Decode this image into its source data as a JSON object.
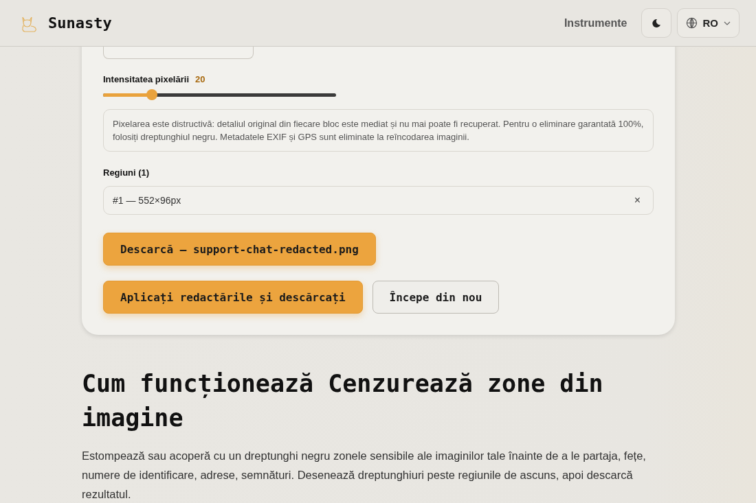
{
  "header": {
    "brand": "Sunasty",
    "nav_link": "Instrumente",
    "language": "RO"
  },
  "intensity": {
    "label": "Intensitatea pixelării",
    "reading": "20",
    "level": 0.21
  },
  "notice": "Pixelarea este distructivă: detaliul original din fiecare bloc este mediat și nu mai poate fi recuperat. Pentru o eliminare garantată 100%, folosiți dreptunghiul negru. Metadatele EXIF și GPS sunt eliminate la reîncodarea imaginii.",
  "regions": {
    "label": "Regiuni (1)",
    "items": [
      {
        "text": "#1 — 552×96px",
        "remove": "×"
      }
    ]
  },
  "download_button": "Descarcă — support-chat-redacted.png",
  "actions": [
    {
      "label": "Aplicați redactările și descărcați",
      "kind": "primary"
    },
    {
      "label": "Începe din nou",
      "kind": "secondary"
    }
  ],
  "article": {
    "heading": "Cum funcționează Cenzurează zone din imagine",
    "paragraph": "Estompează sau acoperă cu un dreptunghi negru zonele sensibile ale imaginilor tale înainte de a le partaja, fețe, numere de identificare, adrese, semnături. Desenează dreptunghiuri peste regiunile de ascuns, apoi descarcă rezultatul."
  }
}
